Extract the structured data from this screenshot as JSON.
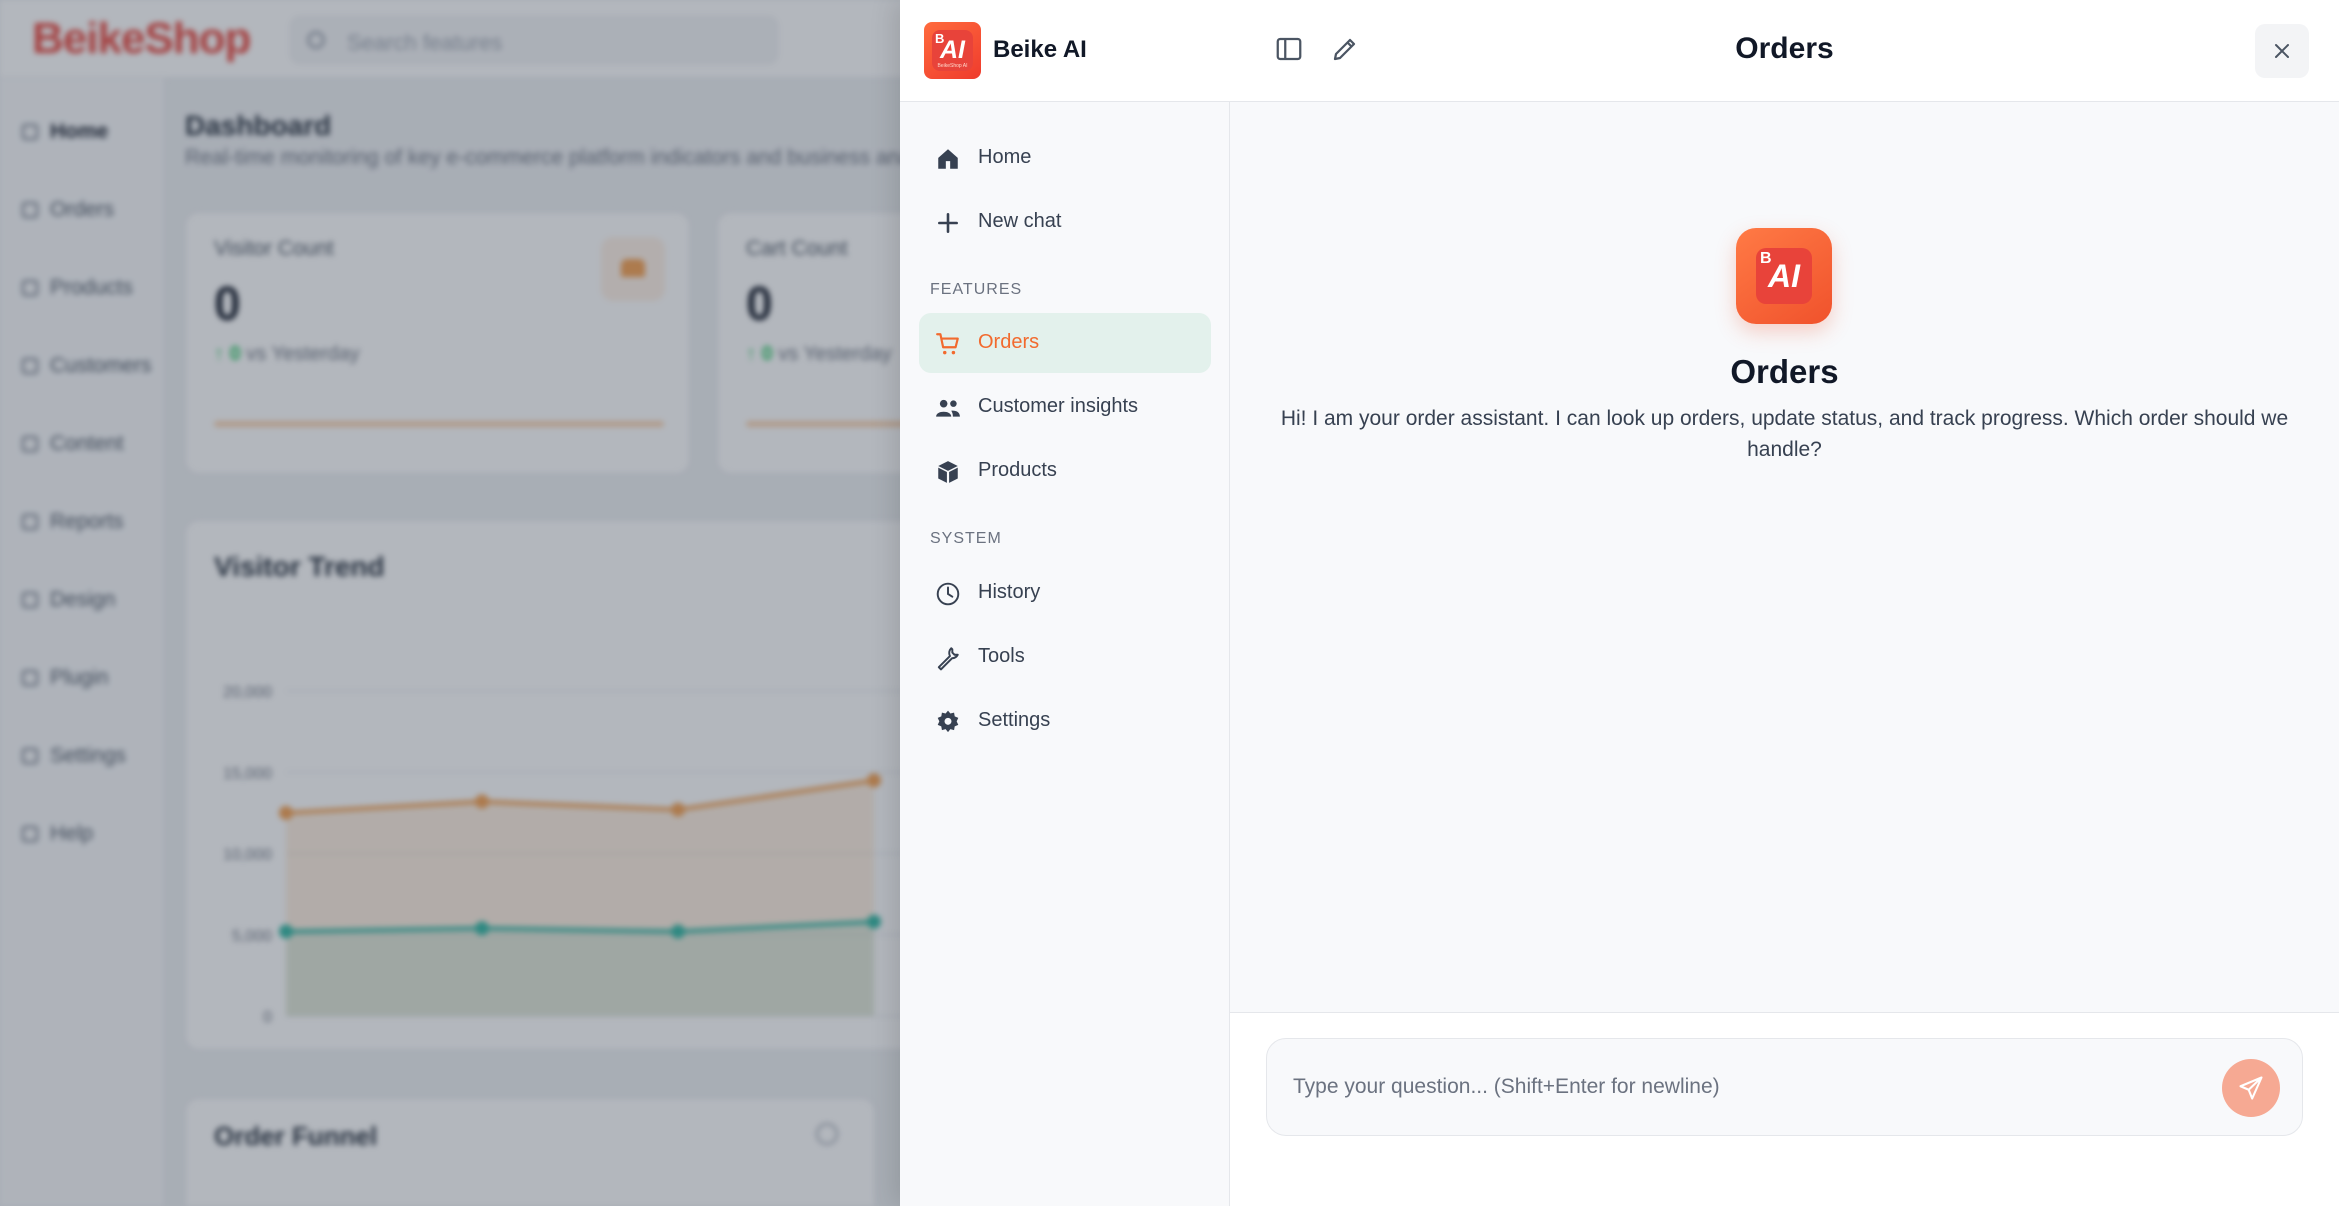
{
  "background": {
    "brand": "BeikeShop",
    "search_placeholder": "Search features",
    "sidebar_items": [
      "Home",
      "Orders",
      "Products",
      "Customers",
      "Content",
      "Reports",
      "Design",
      "Plugin",
      "Settings",
      "Help"
    ],
    "dashboard_title": "Dashboard",
    "dashboard_subtitle": "Real-time monitoring of key e-commerce platform indicators and business analysis",
    "cards": [
      {
        "label": "Visitor Count",
        "value": "0",
        "trend_value": "0",
        "trend_text": "vs Yesterday"
      },
      {
        "label": "Cart Count",
        "value": "0",
        "trend_value": "0",
        "trend_text": "vs Yesterday"
      }
    ],
    "trend_panel_title": "Visitor Trend",
    "funnel_panel_title": "Order Funnel",
    "chart_data": {
      "type": "line",
      "title": "Visitor Trend",
      "yticks": [
        "20,000",
        "15,000",
        "10,000",
        "5,000",
        "0"
      ],
      "ylim": [
        0,
        20000
      ],
      "series": [
        {
          "values": [
            12500,
            13200,
            12700,
            14500
          ]
        },
        {
          "values": [
            5200,
            5400,
            5200,
            5800
          ]
        }
      ]
    }
  },
  "ai_sidebar": {
    "title": "Beike AI",
    "items_top": [
      {
        "label": "Home",
        "icon": "home-icon"
      },
      {
        "label": "New chat",
        "icon": "plus-icon"
      }
    ],
    "features_label": "FEATURES",
    "features": [
      {
        "label": "Orders",
        "icon": "cart-icon",
        "active": true
      },
      {
        "label": "Customer insights",
        "icon": "users-icon"
      },
      {
        "label": "Products",
        "icon": "box-icon"
      }
    ],
    "system_label": "SYSTEM",
    "system": [
      {
        "label": "History",
        "icon": "clock-icon"
      },
      {
        "label": "Tools",
        "icon": "wrench-icon"
      },
      {
        "label": "Settings",
        "icon": "gear-icon"
      }
    ]
  },
  "chat": {
    "title": "Orders",
    "hero_title": "Orders",
    "hero_text": "Hi! I am your order assistant. I can look up orders, update status, and track progress. Which order should we handle?",
    "input_placeholder": "Type your question... (Shift+Enter for newline)"
  },
  "colors": {
    "accent": "#f26a2e",
    "active_bg": "#e3f1ec",
    "send_button": "#f6a993"
  }
}
